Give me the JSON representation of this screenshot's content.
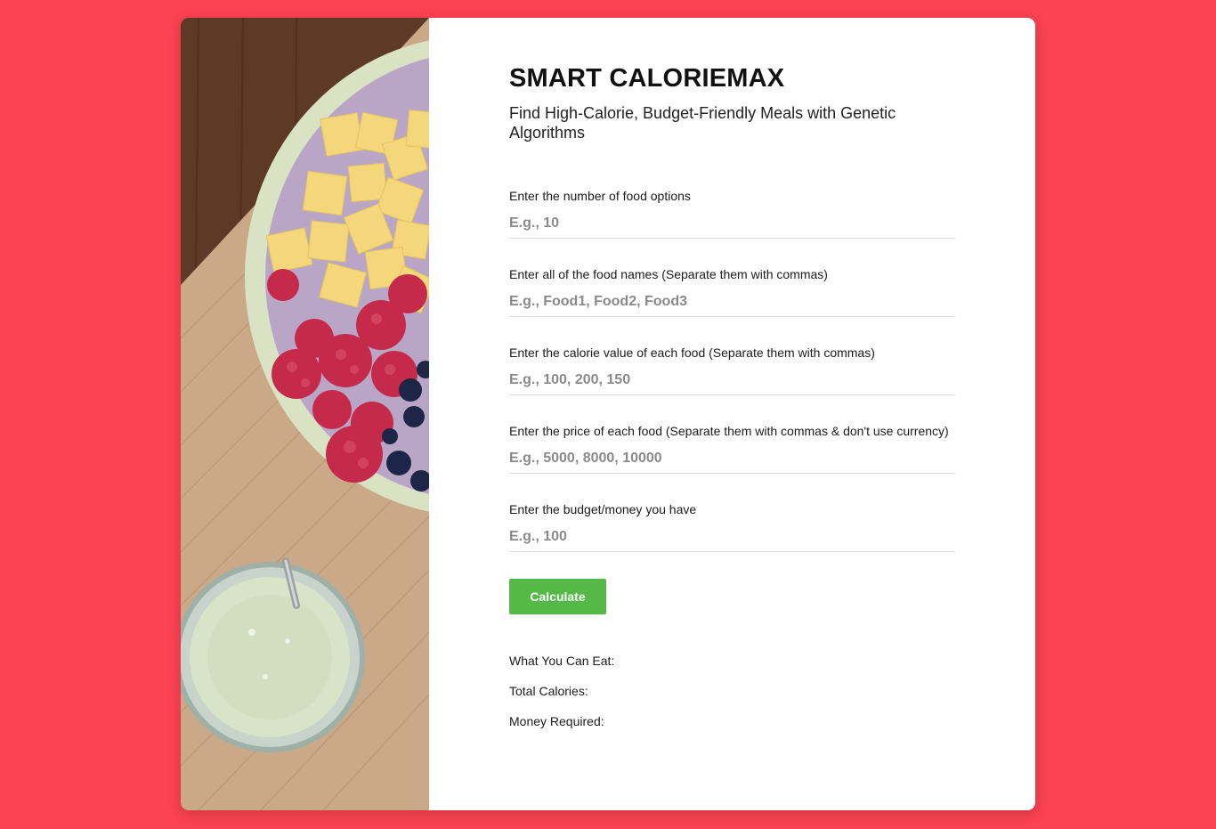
{
  "header": {
    "title": "SMART CALORIEMAX",
    "subtitle": "Find High-Calorie, Budget-Friendly Meals with Genetic Algorithms"
  },
  "fields": [
    {
      "label": "Enter the number of food options",
      "placeholder": "E.g., 10",
      "value": ""
    },
    {
      "label": "Enter all of the food names (Separate them with commas)",
      "placeholder": "E.g., Food1, Food2, Food3",
      "value": ""
    },
    {
      "label": "Enter the calorie value of each food (Separate them with commas)",
      "placeholder": "E.g., 100, 200, 150",
      "value": ""
    },
    {
      "label": "Enter the price of each food (Separate them with commas & don't use currency)",
      "placeholder": "E.g., 5000, 8000, 10000",
      "value": ""
    },
    {
      "label": "Enter the budget/money you have",
      "placeholder": "E.g., 100",
      "value": ""
    }
  ],
  "actions": {
    "calculate_label": "Calculate"
  },
  "results": {
    "foods_label": "What You Can Eat:",
    "calories_label": "Total Calories:",
    "money_label": "Money Required:"
  },
  "colors": {
    "background": "#fb4252",
    "button": "#55b947"
  },
  "icons": {
    "side_image": "food-photo-smoothie-bowl"
  }
}
